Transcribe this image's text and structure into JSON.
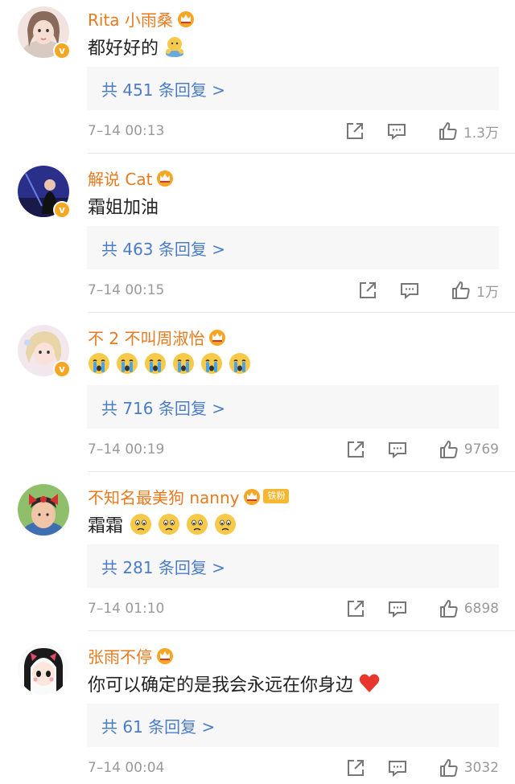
{
  "comments": [
    {
      "user": "Rita 小雨桑",
      "text": "都好好的",
      "emojis": [
        "hands-emoji"
      ],
      "replies": "共 451 条回复 >",
      "time": "7–14 00:13",
      "likes": "1.3万",
      "verified": "v"
    },
    {
      "user": "解说 Cat",
      "text": "霜姐加油",
      "emojis": [],
      "replies": "共 463 条回复 >",
      "time": "7–14 00:15",
      "likes": "1万",
      "verified": "v"
    },
    {
      "user": "不 2 不叫周淑怡",
      "text": "",
      "emojis": [
        "crying-emoji",
        "crying-emoji",
        "crying-emoji",
        "crying-emoji",
        "crying-emoji",
        "crying-emoji"
      ],
      "replies": "共 716 条回复 >",
      "time": "7–14 00:19",
      "likes": "9769",
      "verified": "v"
    },
    {
      "user": "不知名最美狗 nanny",
      "badge": "铁粉",
      "text": "霜霜",
      "emojis": [
        "sad-emoji",
        "sad-emoji",
        "sad-emoji",
        "sad-emoji"
      ],
      "replies": "共 281 条回复 >",
      "time": "7–14 01:10",
      "likes": "6898"
    },
    {
      "user": "张雨不停",
      "text": "你可以确定的是我会永远在你身边",
      "emojis": [
        "heart-emoji"
      ],
      "replies": "共 61 条回复 >",
      "time": "7–14 00:04",
      "likes": "3032"
    }
  ],
  "colors": {
    "username": "#e87a1e",
    "reply_link": "#4b7cc9",
    "meta": "#999999",
    "reply_bg": "#f7f7f7"
  }
}
